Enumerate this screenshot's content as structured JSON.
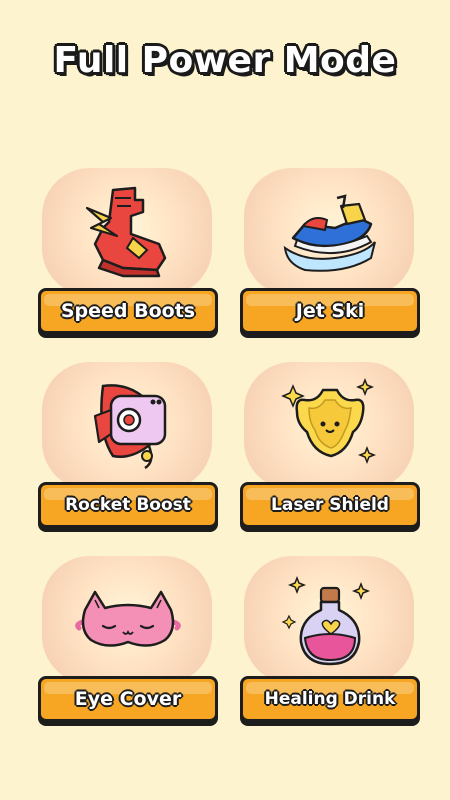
{
  "title": "Full Power Mode",
  "items": [
    {
      "label": "Speed Boots",
      "icon": "speed-boots-icon"
    },
    {
      "label": "Jet Ski",
      "icon": "jet-ski-icon"
    },
    {
      "label": "Rocket Boost",
      "icon": "rocket-icon"
    },
    {
      "label": "Laser Shield",
      "icon": "shield-icon"
    },
    {
      "label": "Eye Cover",
      "icon": "eye-mask-icon"
    },
    {
      "label": "Healing Drink",
      "icon": "potion-icon"
    }
  ],
  "colors": {
    "background": "#fdf3cf",
    "button": "#f6a622",
    "outline": "#1d1d1d"
  }
}
